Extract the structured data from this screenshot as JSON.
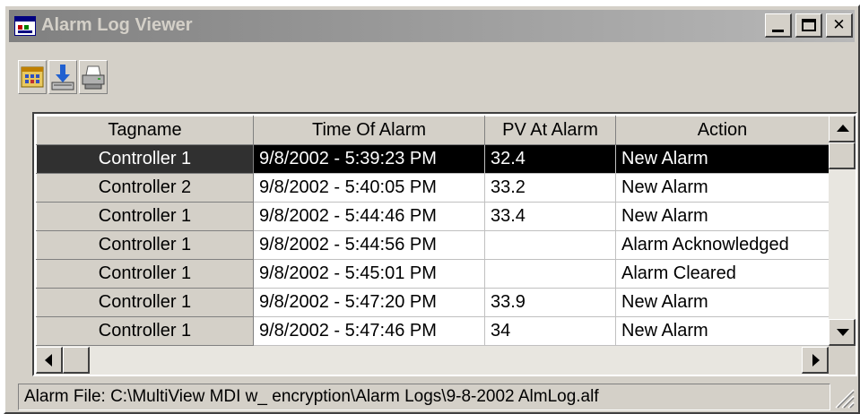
{
  "window": {
    "title": "Alarm Log Viewer"
  },
  "toolbar": {
    "buttons": [
      "open-log-icon",
      "save-download-icon",
      "print-icon"
    ]
  },
  "table": {
    "headers": [
      "Tagname",
      "Time Of Alarm",
      "PV At Alarm",
      "Action"
    ],
    "rows": [
      {
        "tagname": "Controller 1",
        "time": "9/8/2002 - 5:39:23 PM",
        "pv": "32.4",
        "action": "New Alarm",
        "selected": true
      },
      {
        "tagname": "Controller 2",
        "time": "9/8/2002 - 5:40:05 PM",
        "pv": "33.2",
        "action": "New Alarm"
      },
      {
        "tagname": "Controller 1",
        "time": "9/8/2002 - 5:44:46 PM",
        "pv": "33.4",
        "action": "New Alarm"
      },
      {
        "tagname": "Controller 1",
        "time": "9/8/2002 - 5:44:56 PM",
        "pv": "",
        "action": "Alarm Acknowledged"
      },
      {
        "tagname": "Controller 1",
        "time": "9/8/2002 - 5:45:01 PM",
        "pv": "",
        "action": "Alarm Cleared"
      },
      {
        "tagname": "Controller 1",
        "time": "9/8/2002 - 5:47:20 PM",
        "pv": "33.9",
        "action": "New Alarm"
      },
      {
        "tagname": "Controller 1",
        "time": "9/8/2002 - 5:47:46 PM",
        "pv": "34",
        "action": "New Alarm"
      }
    ]
  },
  "status": {
    "text": "Alarm File: C:\\MultiView MDI w_ encryption\\Alarm Logs\\9-8-2002 AlmLog.alf"
  },
  "colors": {
    "title_gradient_start": "#808080",
    "title_gradient_end": "#b8b8b8",
    "face": "#d4d0c8",
    "selection": "#000000"
  }
}
